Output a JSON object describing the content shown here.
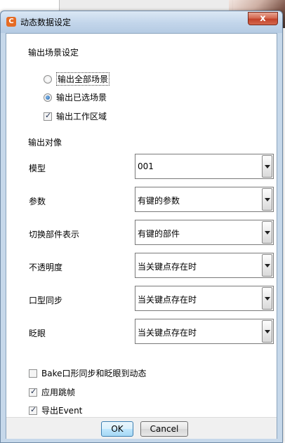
{
  "window": {
    "title": "动态数据设定",
    "close_glyph": "x",
    "app_icon_glyph": "C"
  },
  "scene_section": {
    "label": "输出场景设定",
    "options": [
      {
        "label": "输出全部场景",
        "selected": false
      },
      {
        "label": "输出已选场景",
        "selected": true
      }
    ],
    "work_area": {
      "label": "输出工作区域",
      "checked": true
    }
  },
  "target_section": {
    "label": "输出对像",
    "fields": [
      {
        "label": "模型",
        "value": "001"
      },
      {
        "label": "参数",
        "value": "有键的参数"
      },
      {
        "label": "切换部件表示",
        "value": "有键的部件"
      },
      {
        "label": "不透明度",
        "value": "当关键点存在时"
      },
      {
        "label": "口型同步",
        "value": "当关键点存在时"
      },
      {
        "label": "眨眼",
        "value": "当关键点存在时"
      }
    ]
  },
  "options": [
    {
      "label": "Bake口形同步和眨眼到动态",
      "checked": false
    },
    {
      "label": "应用跳帧",
      "checked": true
    },
    {
      "label": "导出Event",
      "checked": true
    }
  ],
  "footer": {
    "ok_label": "OK",
    "cancel_label": "Cancel"
  },
  "colors": {
    "accent": "#3c7fb1",
    "titlebar": "#c2d5ea",
    "close": "#c3422a"
  }
}
